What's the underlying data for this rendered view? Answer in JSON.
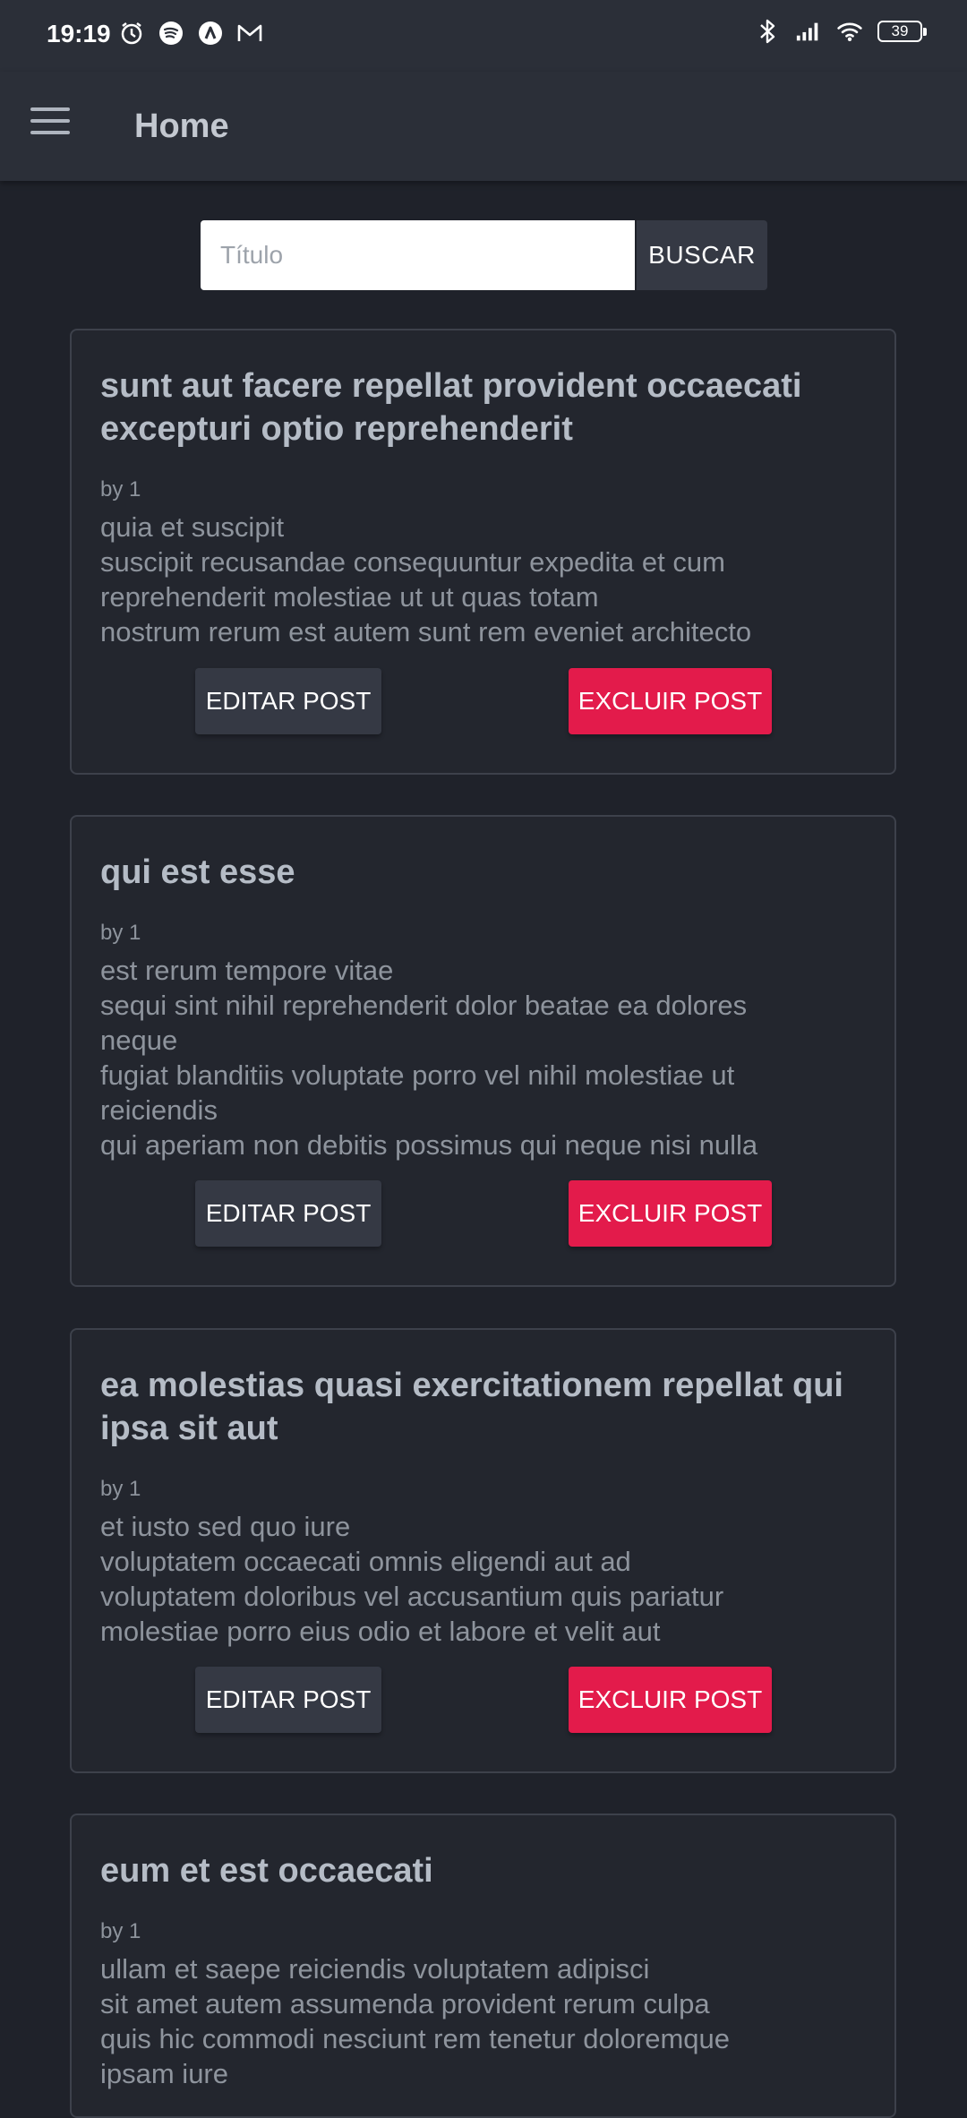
{
  "status_bar": {
    "time": "19:19",
    "icons_left": [
      "alarm-icon",
      "spotify-icon",
      "app-a-icon",
      "gmail-icon"
    ],
    "icons_right": [
      "bluetooth-icon",
      "signal-icon",
      "wifi-icon"
    ],
    "battery": "39"
  },
  "app_bar": {
    "title": "Home",
    "menu_icon": "hamburger-menu-icon"
  },
  "search": {
    "placeholder": "Título",
    "value": "",
    "button_label": "BUSCAR"
  },
  "posts": [
    {
      "title": "sunt aut facere repellat provident occaecati excepturi optio reprehenderit",
      "author": "by 1",
      "body": "quia et suscipit\nsuscipit recusandae consequuntur expedita et cum\nreprehenderit molestiae ut ut quas totam\nnostrum rerum est autem sunt rem eveniet architecto",
      "edit_label": "EDITAR POST",
      "delete_label": "EXCLUIR POST"
    },
    {
      "title": "qui est esse",
      "author": "by 1",
      "body": "est rerum tempore vitae\nsequi sint nihil reprehenderit dolor beatae ea dolores\nneque\nfugiat blanditiis voluptate porro vel nihil molestiae ut\nreiciendis\nqui aperiam non debitis possimus qui neque nisi nulla",
      "edit_label": "EDITAR POST",
      "delete_label": "EXCLUIR POST"
    },
    {
      "title": "ea molestias quasi exercitationem repellat qui ipsa sit aut",
      "author": "by 1",
      "body": "et iusto sed quo iure\nvoluptatem occaecati omnis eligendi aut ad\nvoluptatem doloribus vel accusantium quis pariatur\nmolestiae porro eius odio et labore et velit aut",
      "edit_label": "EDITAR POST",
      "delete_label": "EXCLUIR POST"
    },
    {
      "title": "eum et est occaecati",
      "author": "by 1",
      "body": "ullam et saepe reiciendis voluptatem adipisci\nsit amet autem assumenda provident rerum culpa\nquis hic commodi nesciunt rem tenetur doloremque\nipsam iure"
    }
  ],
  "colors": {
    "background": "#1f222a",
    "app_bar": "#2b2f38",
    "card": "#23262e",
    "edit_button": "#353944",
    "delete_button": "#e31b4b"
  }
}
